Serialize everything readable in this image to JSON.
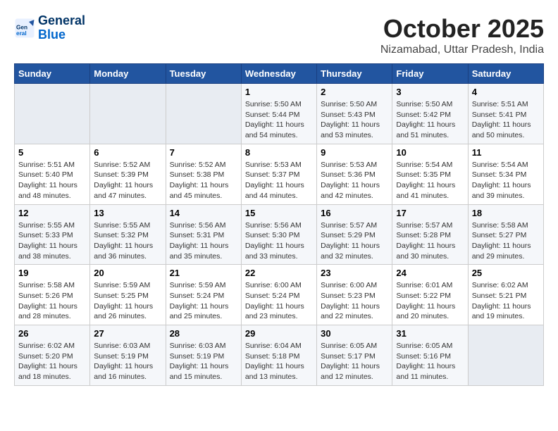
{
  "header": {
    "logo_line1": "General",
    "logo_line2": "Blue",
    "month": "October 2025",
    "location": "Nizamabad, Uttar Pradesh, India"
  },
  "weekdays": [
    "Sunday",
    "Monday",
    "Tuesday",
    "Wednesday",
    "Thursday",
    "Friday",
    "Saturday"
  ],
  "weeks": [
    [
      {
        "day": "",
        "sunrise": "",
        "sunset": "",
        "daylight": "",
        "empty": true
      },
      {
        "day": "",
        "sunrise": "",
        "sunset": "",
        "daylight": "",
        "empty": true
      },
      {
        "day": "",
        "sunrise": "",
        "sunset": "",
        "daylight": "",
        "empty": true
      },
      {
        "day": "1",
        "sunrise": "Sunrise: 5:50 AM",
        "sunset": "Sunset: 5:44 PM",
        "daylight": "Daylight: 11 hours and 54 minutes."
      },
      {
        "day": "2",
        "sunrise": "Sunrise: 5:50 AM",
        "sunset": "Sunset: 5:43 PM",
        "daylight": "Daylight: 11 hours and 53 minutes."
      },
      {
        "day": "3",
        "sunrise": "Sunrise: 5:50 AM",
        "sunset": "Sunset: 5:42 PM",
        "daylight": "Daylight: 11 hours and 51 minutes."
      },
      {
        "day": "4",
        "sunrise": "Sunrise: 5:51 AM",
        "sunset": "Sunset: 5:41 PM",
        "daylight": "Daylight: 11 hours and 50 minutes."
      }
    ],
    [
      {
        "day": "5",
        "sunrise": "Sunrise: 5:51 AM",
        "sunset": "Sunset: 5:40 PM",
        "daylight": "Daylight: 11 hours and 48 minutes."
      },
      {
        "day": "6",
        "sunrise": "Sunrise: 5:52 AM",
        "sunset": "Sunset: 5:39 PM",
        "daylight": "Daylight: 11 hours and 47 minutes."
      },
      {
        "day": "7",
        "sunrise": "Sunrise: 5:52 AM",
        "sunset": "Sunset: 5:38 PM",
        "daylight": "Daylight: 11 hours and 45 minutes."
      },
      {
        "day": "8",
        "sunrise": "Sunrise: 5:53 AM",
        "sunset": "Sunset: 5:37 PM",
        "daylight": "Daylight: 11 hours and 44 minutes."
      },
      {
        "day": "9",
        "sunrise": "Sunrise: 5:53 AM",
        "sunset": "Sunset: 5:36 PM",
        "daylight": "Daylight: 11 hours and 42 minutes."
      },
      {
        "day": "10",
        "sunrise": "Sunrise: 5:54 AM",
        "sunset": "Sunset: 5:35 PM",
        "daylight": "Daylight: 11 hours and 41 minutes."
      },
      {
        "day": "11",
        "sunrise": "Sunrise: 5:54 AM",
        "sunset": "Sunset: 5:34 PM",
        "daylight": "Daylight: 11 hours and 39 minutes."
      }
    ],
    [
      {
        "day": "12",
        "sunrise": "Sunrise: 5:55 AM",
        "sunset": "Sunset: 5:33 PM",
        "daylight": "Daylight: 11 hours and 38 minutes."
      },
      {
        "day": "13",
        "sunrise": "Sunrise: 5:55 AM",
        "sunset": "Sunset: 5:32 PM",
        "daylight": "Daylight: 11 hours and 36 minutes."
      },
      {
        "day": "14",
        "sunrise": "Sunrise: 5:56 AM",
        "sunset": "Sunset: 5:31 PM",
        "daylight": "Daylight: 11 hours and 35 minutes."
      },
      {
        "day": "15",
        "sunrise": "Sunrise: 5:56 AM",
        "sunset": "Sunset: 5:30 PM",
        "daylight": "Daylight: 11 hours and 33 minutes."
      },
      {
        "day": "16",
        "sunrise": "Sunrise: 5:57 AM",
        "sunset": "Sunset: 5:29 PM",
        "daylight": "Daylight: 11 hours and 32 minutes."
      },
      {
        "day": "17",
        "sunrise": "Sunrise: 5:57 AM",
        "sunset": "Sunset: 5:28 PM",
        "daylight": "Daylight: 11 hours and 30 minutes."
      },
      {
        "day": "18",
        "sunrise": "Sunrise: 5:58 AM",
        "sunset": "Sunset: 5:27 PM",
        "daylight": "Daylight: 11 hours and 29 minutes."
      }
    ],
    [
      {
        "day": "19",
        "sunrise": "Sunrise: 5:58 AM",
        "sunset": "Sunset: 5:26 PM",
        "daylight": "Daylight: 11 hours and 28 minutes."
      },
      {
        "day": "20",
        "sunrise": "Sunrise: 5:59 AM",
        "sunset": "Sunset: 5:25 PM",
        "daylight": "Daylight: 11 hours and 26 minutes."
      },
      {
        "day": "21",
        "sunrise": "Sunrise: 5:59 AM",
        "sunset": "Sunset: 5:24 PM",
        "daylight": "Daylight: 11 hours and 25 minutes."
      },
      {
        "day": "22",
        "sunrise": "Sunrise: 6:00 AM",
        "sunset": "Sunset: 5:24 PM",
        "daylight": "Daylight: 11 hours and 23 minutes."
      },
      {
        "day": "23",
        "sunrise": "Sunrise: 6:00 AM",
        "sunset": "Sunset: 5:23 PM",
        "daylight": "Daylight: 11 hours and 22 minutes."
      },
      {
        "day": "24",
        "sunrise": "Sunrise: 6:01 AM",
        "sunset": "Sunset: 5:22 PM",
        "daylight": "Daylight: 11 hours and 20 minutes."
      },
      {
        "day": "25",
        "sunrise": "Sunrise: 6:02 AM",
        "sunset": "Sunset: 5:21 PM",
        "daylight": "Daylight: 11 hours and 19 minutes."
      }
    ],
    [
      {
        "day": "26",
        "sunrise": "Sunrise: 6:02 AM",
        "sunset": "Sunset: 5:20 PM",
        "daylight": "Daylight: 11 hours and 18 minutes."
      },
      {
        "day": "27",
        "sunrise": "Sunrise: 6:03 AM",
        "sunset": "Sunset: 5:19 PM",
        "daylight": "Daylight: 11 hours and 16 minutes."
      },
      {
        "day": "28",
        "sunrise": "Sunrise: 6:03 AM",
        "sunset": "Sunset: 5:19 PM",
        "daylight": "Daylight: 11 hours and 15 minutes."
      },
      {
        "day": "29",
        "sunrise": "Sunrise: 6:04 AM",
        "sunset": "Sunset: 5:18 PM",
        "daylight": "Daylight: 11 hours and 13 minutes."
      },
      {
        "day": "30",
        "sunrise": "Sunrise: 6:05 AM",
        "sunset": "Sunset: 5:17 PM",
        "daylight": "Daylight: 11 hours and 12 minutes."
      },
      {
        "day": "31",
        "sunrise": "Sunrise: 6:05 AM",
        "sunset": "Sunset: 5:16 PM",
        "daylight": "Daylight: 11 hours and 11 minutes."
      },
      {
        "day": "",
        "sunrise": "",
        "sunset": "",
        "daylight": "",
        "empty": true
      }
    ]
  ]
}
